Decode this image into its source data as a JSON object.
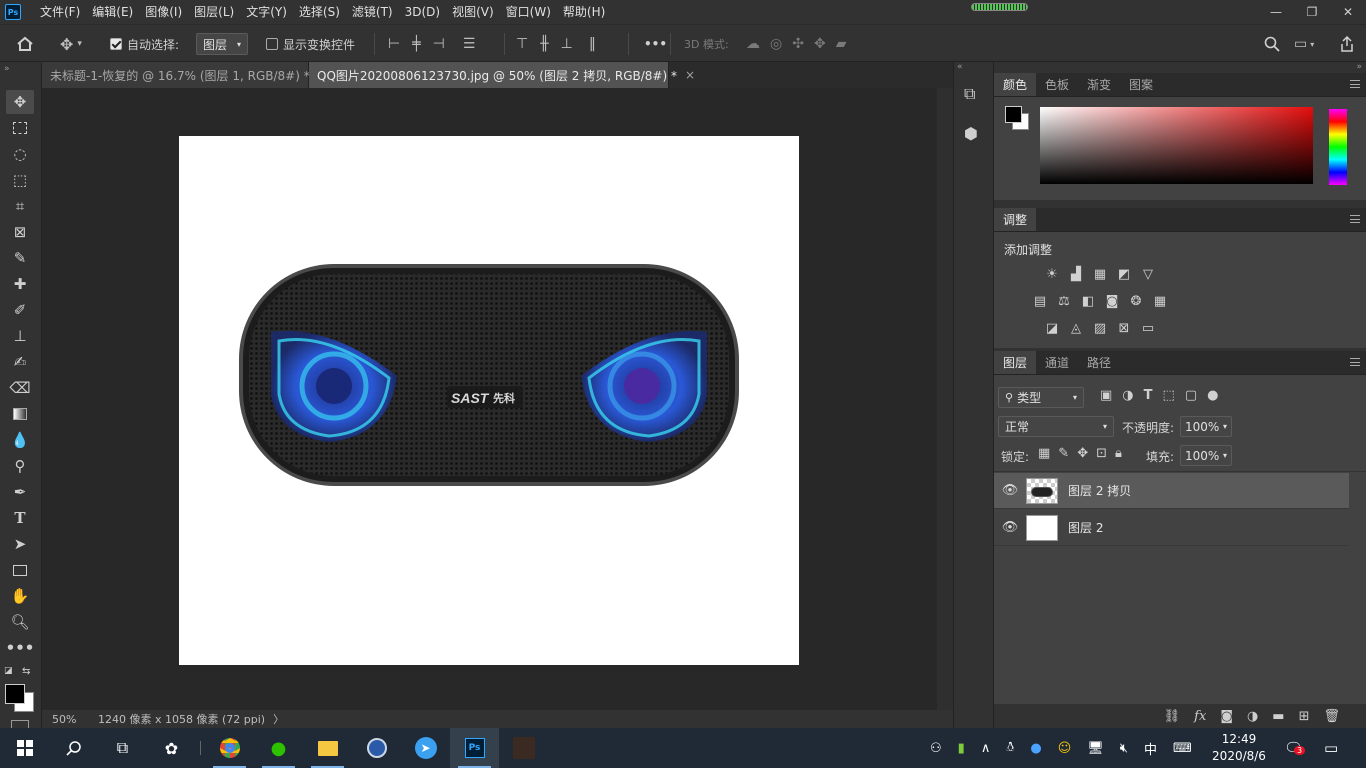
{
  "menubar": {
    "logo": "Ps",
    "items": [
      "文件(F)",
      "编辑(E)",
      "图像(I)",
      "图层(L)",
      "文字(Y)",
      "选择(S)",
      "滤镜(T)",
      "3D(D)",
      "视图(V)",
      "窗口(W)",
      "帮助(H)"
    ]
  },
  "options": {
    "auto_select_label": "自动选择:",
    "auto_select_target": "图层",
    "show_transform_label": "显示变换控件",
    "mode_3d_label": "3D 模式:",
    "more": "•••"
  },
  "tabs": [
    {
      "label": "未标题-1-恢复的 @ 16.7% (图层 1, RGB/8#) *",
      "close": "×"
    },
    {
      "label": "QQ图片20200806123730.jpg @ 50% (图层 2 拷贝, RGB/8#) *",
      "close": "×"
    }
  ],
  "product": {
    "brand": "SAST",
    "brand_cn": "先科"
  },
  "status": {
    "zoom": "50%",
    "doc_info": "1240 像素 x 1058 像素 (72 ppi)",
    "arrow": "〉"
  },
  "color_panel": {
    "tabs": [
      "颜色",
      "色板",
      "渐变",
      "图案"
    ]
  },
  "adjust_panel": {
    "tab": "调整",
    "title": "添加调整"
  },
  "layers_panel": {
    "tabs": [
      "图层",
      "通道",
      "路径"
    ],
    "filter_kind": "类型",
    "blend_mode": "正常",
    "opacity_label": "不透明度:",
    "opacity_value": "100%",
    "lock_label": "锁定:",
    "fill_label": "填充:",
    "fill_value": "100%",
    "layers": [
      {
        "name": "图层 2 拷贝",
        "selected": true
      },
      {
        "name": "图层 2",
        "selected": false
      }
    ]
  },
  "taskbar": {
    "clock_time": "12:49",
    "clock_date": "2020/8/6",
    "ime": "中",
    "notify_count": "3"
  },
  "colors": {
    "accent_ps": "#31a8ff",
    "fg_swatch": "#000000",
    "bg_swatch": "#ffffff"
  }
}
